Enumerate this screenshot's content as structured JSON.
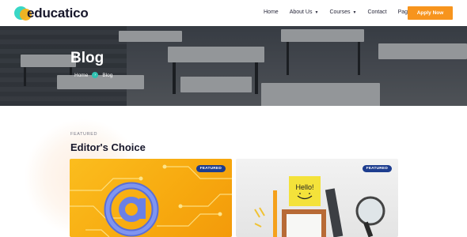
{
  "brand": {
    "name": "educatico"
  },
  "nav": {
    "items": [
      {
        "label": "Home",
        "has_dropdown": false
      },
      {
        "label": "About Us",
        "has_dropdown": true
      },
      {
        "label": "Courses",
        "has_dropdown": true
      },
      {
        "label": "Contact",
        "has_dropdown": false
      },
      {
        "label": "Page",
        "has_dropdown": true
      }
    ],
    "cta_label": "Apply Now"
  },
  "hero": {
    "title": "Blog",
    "breadcrumb": {
      "home": "Home",
      "current": "Blog"
    }
  },
  "section": {
    "eyebrow": "FEATURED",
    "title": "Editor's Choice"
  },
  "cards": [
    {
      "badge": "FEATURED",
      "image_icon": "at-sign-icon"
    },
    {
      "badge": "FEATURED",
      "sticky_note_text": "Hello!"
    }
  ],
  "colors": {
    "accent": "#f7941d",
    "teal": "#2fc1b0",
    "badge": "#1d3d8f",
    "text": "#17172b"
  }
}
